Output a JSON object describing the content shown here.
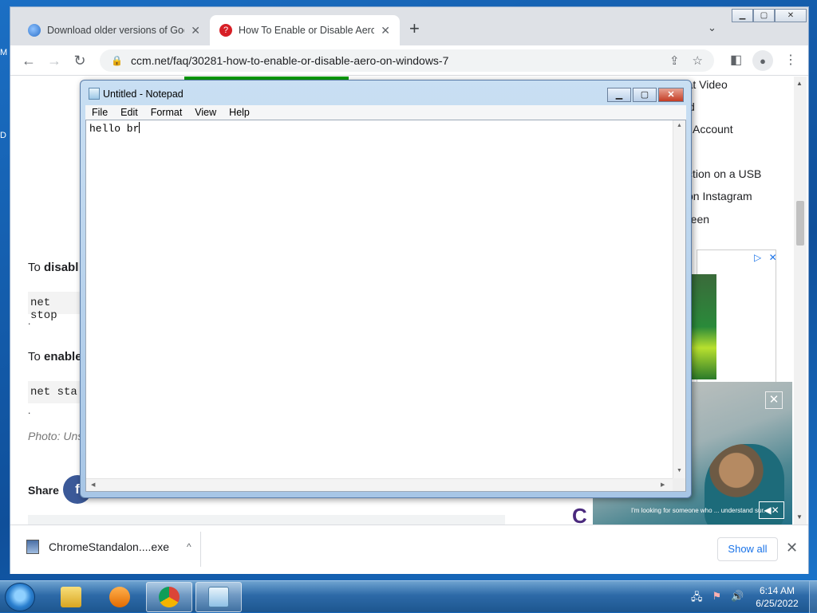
{
  "desktop": {
    "label_m": "M",
    "label_d": "D"
  },
  "chrome": {
    "tabs": [
      {
        "title": "Download older versions of Goo",
        "close": "✕"
      },
      {
        "title": "How To Enable or Disable Aero o",
        "close": "✕"
      }
    ],
    "new_tab": "+",
    "tab_menu": "⌄",
    "window_controls": {
      "minimize": "▁",
      "maximize": "▢",
      "close": "✕"
    },
    "toolbar": {
      "back": "←",
      "forward": "→",
      "reload": "↻"
    },
    "url": "ccm.net/faq/30281-how-to-enable-or-disable-aero-on-windows-7",
    "url_icon": "🔒",
    "omni_actions": {
      "share": "⇪",
      "star": "☆"
    },
    "sidebar_icon": "◧",
    "profile_icon": "●",
    "menu_icon": "⋮",
    "article": {
      "disable_prefix": "To ",
      "disable_bold": "disabl",
      "code_stop": "net stop",
      "dot1": ".",
      "enable_prefix": "To ",
      "enable_bold": "enable",
      "code_start": "net sta",
      "dot2": ".",
      "photo": "Photo: Uns",
      "share_label": "Share",
      "facebook_icon": "f"
    },
    "sidebar_links": [
      "How to Fix a Blurry Snapchat Video",
      "d",
      "Account",
      "ction on a USB",
      "on Instagram",
      "reen"
    ],
    "ad": {
      "adchoices": "▷",
      "close": "✕"
    },
    "video": {
      "caption": "I'm looking for someone who ... understand sur.",
      "close": "✕",
      "mute": "◀✕"
    },
    "logo_fragment": "C",
    "downloads": {
      "file": "ChromeStandalon....exe",
      "chevron": "^",
      "show_all": "Show all",
      "close": "✕"
    }
  },
  "notepad": {
    "title": "Untitled - Notepad",
    "menu": [
      "File",
      "Edit",
      "Format",
      "View",
      "Help"
    ],
    "text": "hello br",
    "controls": {
      "minimize": "▁",
      "maximize": "▢",
      "close": "✕"
    }
  },
  "taskbar": {
    "time": "6:14 AM",
    "date": "6/25/2022",
    "tray": {
      "network": "🖧",
      "flag": "⚑",
      "volume": "🔊"
    }
  }
}
